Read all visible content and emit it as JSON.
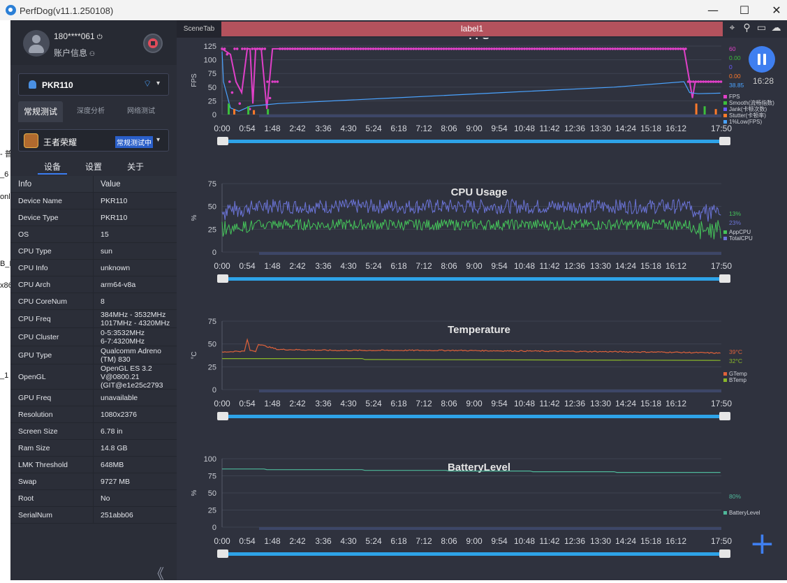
{
  "app": {
    "title": "PerfDog(v11.1.250108)",
    "min": "—",
    "max": "☐",
    "close": "✕"
  },
  "leftstrip": [
    "- 普",
    "_6",
    "onl",
    "B_R",
    "x86",
    "_1"
  ],
  "user": {
    "name": "180****061",
    "power_icon": "⏻",
    "info": "账户信息",
    "info_icon": "⚇"
  },
  "device": {
    "name": "PKR110",
    "wifi_icon": "wifi-icon",
    "caret": "▾"
  },
  "mode_tabs": [
    "常规测试",
    "深度分析",
    "网络测试"
  ],
  "app_select": {
    "name": "王者荣耀",
    "badge": "常规测试中",
    "caret": "▾"
  },
  "sub_tabs": [
    "设备",
    "设置",
    "关于"
  ],
  "info_table": {
    "headers": [
      "Info",
      "Value"
    ],
    "rows": [
      [
        "Device Name",
        "PKR110"
      ],
      [
        "Device Type",
        "PKR110"
      ],
      [
        "OS",
        "15"
      ],
      [
        "CPU Type",
        "sun"
      ],
      [
        "CPU Info",
        "unknown"
      ],
      [
        "CPU Arch",
        "arm64-v8a"
      ],
      [
        "CPU CoreNum",
        "8"
      ],
      [
        "CPU Freq",
        "384MHz - 3532MHz\n1017MHz - 4320MHz"
      ],
      [
        "CPU Cluster",
        "0-5:3532MHz\n6-7:4320MHz"
      ],
      [
        "GPU Type",
        "Qualcomm Adreno\n(TM) 830"
      ],
      [
        "OpenGL",
        "OpenGL ES 3.2\nV@0800.21\n(GIT@e1e25c2793"
      ],
      [
        "GPU Freq",
        "unavailable"
      ],
      [
        "Resolution",
        "1080x2376"
      ],
      [
        "Screen Size",
        "6.78 in"
      ],
      [
        "Ram Size",
        "14.8 GB"
      ],
      [
        "LMK Threshold",
        "648MB"
      ],
      [
        "Swap",
        "9727 MB"
      ],
      [
        "Root",
        "No"
      ],
      [
        "SerialNum",
        "251abb06"
      ]
    ]
  },
  "collapse_icon": "《",
  "scene": {
    "tab": "SceneTab",
    "label": "label1",
    "icons": [
      "location-icon",
      "pin-icon",
      "folder-icon",
      "cloud-icon"
    ]
  },
  "clock": "16:28",
  "time_ticks": [
    "0:00",
    "0:54",
    "1:48",
    "2:42",
    "3:36",
    "4:30",
    "5:24",
    "6:18",
    "7:12",
    "8:06",
    "9:00",
    "9:54",
    "10:48",
    "11:42",
    "12:36",
    "13:30",
    "14:24",
    "15:18",
    "16:12",
    "17:50"
  ],
  "colors": {
    "fps": "#e040c8",
    "smooth": "#3cbf3c",
    "jank": "#6a5cff",
    "stutter": "#ff7a2a",
    "low1": "#4aa3ff",
    "app_cpu": "#45c45a",
    "total_cpu": "#6b74d8",
    "gtemp": "#e0623a",
    "btemp": "#8ab72a",
    "battery": "#4fb89a"
  },
  "chart_data": [
    {
      "type": "line",
      "title": "FPS",
      "ylabel": "FPS",
      "ylim": [
        0,
        125
      ],
      "yticks": [
        0,
        25,
        50,
        75,
        100,
        125
      ],
      "x_range": [
        "0:00",
        "17:50"
      ],
      "current_values": [
        "60",
        "0.00",
        "0",
        "0.00",
        "38.85"
      ],
      "legend": [
        "FPS",
        "Smooth(流畅指数)",
        "Jank(卡顿次数)",
        "Stutter(卡顿率)",
        "1%Low(FPS)"
      ],
      "series": [
        {
          "name": "FPS",
          "x_min": [
            0,
            0.3,
            0.5,
            0.7,
            0.9,
            1.0,
            1.1,
            1.2,
            1.4,
            1.6,
            1.8,
            2.0,
            5,
            10,
            15,
            16.5,
            16.7,
            16.8,
            16.9,
            17.0,
            17.5,
            17.8
          ],
          "values": [
            120,
            110,
            60,
            40,
            120,
            120,
            20,
            120,
            120,
            10,
            120,
            120,
            120,
            120,
            120,
            120,
            60,
            30,
            60,
            60,
            60,
            60
          ]
        },
        {
          "name": "1%Low(FPS)",
          "x_min": [
            0,
            0.05,
            0.3,
            0.6,
            1.0,
            2.0,
            6,
            10,
            14,
            16.5,
            16.7,
            17.0,
            17.8
          ],
          "values": [
            115,
            60,
            12,
            6,
            15,
            20,
            30,
            40,
            50,
            60,
            40,
            38,
            39
          ]
        }
      ]
    },
    {
      "type": "line",
      "title": "CPU Usage",
      "ylabel": "%",
      "ylim": [
        0,
        75
      ],
      "yticks": [
        0,
        25,
        50,
        75
      ],
      "x_range": [
        "0:00",
        "17:50"
      ],
      "current_values": [
        "13%",
        "23%"
      ],
      "legend": [
        "AppCPU",
        "TotalCPU"
      ],
      "series": [
        {
          "name": "AppCPU",
          "level": 30
        },
        {
          "name": "TotalCPU",
          "level": 50
        }
      ]
    },
    {
      "type": "line",
      "title": "Temperature",
      "ylabel": "°C",
      "ylim": [
        0,
        75
      ],
      "yticks": [
        0,
        25,
        50,
        75
      ],
      "x_range": [
        "0:00",
        "17:50"
      ],
      "current_values": [
        "39°C",
        "32°C"
      ],
      "legend": [
        "GTemp",
        "BTemp"
      ],
      "series": [
        {
          "name": "GTemp",
          "x_min": [
            0,
            0.5,
            0.8,
            0.9,
            1.0,
            1.2,
            1.3,
            1.5,
            2,
            4,
            8,
            12,
            16,
            17.8
          ],
          "values": [
            41,
            42,
            42,
            55,
            43,
            42,
            50,
            48,
            44,
            43,
            43,
            42,
            41,
            40
          ]
        },
        {
          "name": "BTemp",
          "x_min": [
            0,
            5,
            5.1,
            17.8
          ],
          "values": [
            34,
            34,
            33,
            32
          ]
        }
      ]
    },
    {
      "type": "line",
      "title": "BatteryLevel",
      "ylabel": "%",
      "ylim": [
        0,
        100
      ],
      "yticks": [
        0,
        25,
        50,
        75,
        100
      ],
      "x_range": [
        "0:00",
        "17:50"
      ],
      "current_values": [
        "80%"
      ],
      "legend": [
        "BatteryLevel"
      ],
      "series": [
        {
          "name": "BatteryLevel",
          "x_min": [
            0,
            1.5,
            1.6,
            5,
            5.1,
            8,
            8.1,
            11,
            11.1,
            14,
            14.1,
            17.8
          ],
          "values": [
            85,
            85,
            84,
            84,
            83,
            83,
            82,
            82,
            81,
            81,
            80,
            80
          ]
        }
      ]
    }
  ]
}
